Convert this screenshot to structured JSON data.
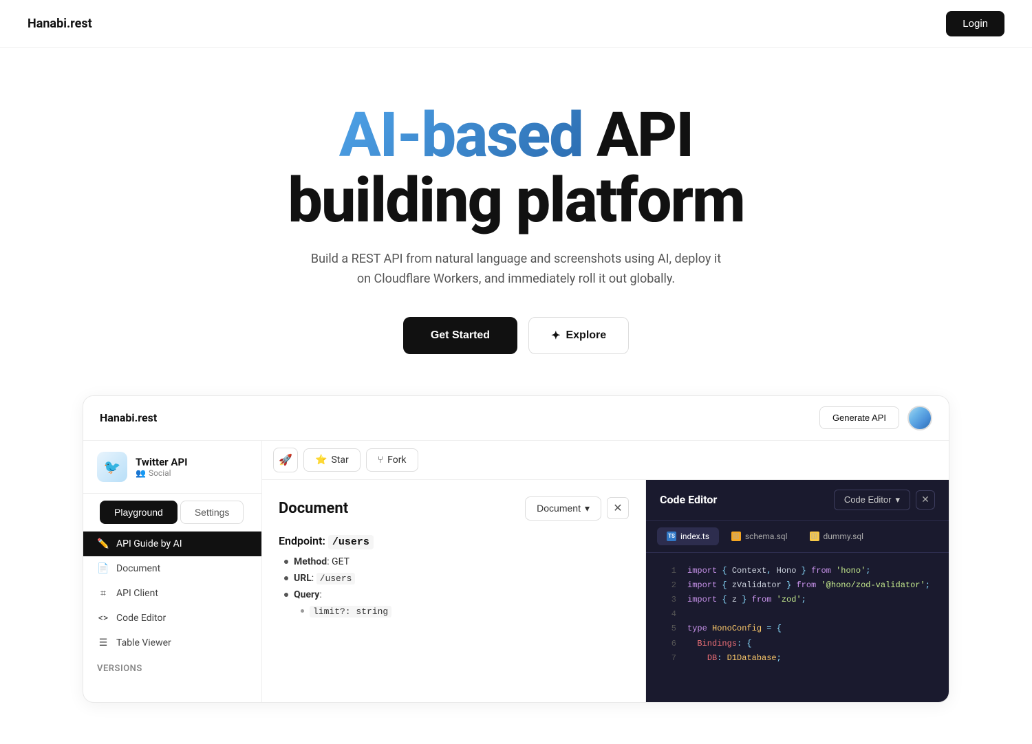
{
  "navbar": {
    "logo": "Hanabi.rest",
    "login_label": "Login"
  },
  "hero": {
    "title_blue": "AI-based",
    "title_rest": " API",
    "title_line2": "building platform",
    "subtitle": "Build a REST API from natural language and screenshots using AI, deploy it on Cloudflare Workers, and immediately roll it out globally.",
    "cta_primary": "Get Started",
    "cta_secondary": "Explore",
    "explore_icon": "✦"
  },
  "demo": {
    "brand": "Hanabi.rest",
    "generate_api_label": "Generate API",
    "project": {
      "name": "Twitter API",
      "category": "Social",
      "category_icon": "👥"
    },
    "tabs": {
      "playground": "Playground",
      "settings": "Settings",
      "rocket_icon": "🚀",
      "star_label": "Star",
      "fork_label": "Fork"
    },
    "sidebar_nav": [
      {
        "id": "api-guide",
        "icon": "✏️",
        "label": "API Guide by AI",
        "active": true
      },
      {
        "id": "document",
        "icon": "📄",
        "label": "Document",
        "active": false
      },
      {
        "id": "api-client",
        "icon": "⌗",
        "label": "API Client",
        "active": false
      },
      {
        "id": "code-editor",
        "icon": "<>",
        "label": "Code Editor",
        "active": false
      },
      {
        "id": "table-viewer",
        "icon": "☰",
        "label": "Table Viewer",
        "active": false
      }
    ],
    "sidebar_versions_label": "Versions",
    "document_panel": {
      "title": "Document",
      "dropdown_label": "Document",
      "endpoint_label": "Endpoint:",
      "endpoint_path": "/users",
      "items": [
        {
          "label": "Method",
          "value": ": GET"
        },
        {
          "label": "URL",
          "value": ": /users"
        },
        {
          "label": "Query",
          "value": ":"
        }
      ],
      "query_sub": [
        {
          "label": "limit?: string"
        }
      ]
    },
    "code_editor": {
      "title": "Code Editor",
      "dropdown_label": "Code Editor",
      "tabs": [
        {
          "id": "index-ts",
          "label": "index.ts",
          "type": "ts",
          "active": true
        },
        {
          "id": "schema-sql",
          "label": "schema.sql",
          "type": "sql-orange",
          "active": false
        },
        {
          "id": "dummy-sql",
          "label": "dummy.sql",
          "type": "sql-yellow",
          "active": false
        }
      ],
      "lines": [
        {
          "num": 1,
          "content": "import { Context, Hono } from 'hono';"
        },
        {
          "num": 2,
          "content": "import { zValidator } from '@hono/zod-validator';"
        },
        {
          "num": 3,
          "content": "import { z } from 'zod';"
        },
        {
          "num": 4,
          "content": ""
        },
        {
          "num": 5,
          "content": "type HonoConfig = {"
        },
        {
          "num": 6,
          "content": "  Bindings: {"
        },
        {
          "num": 7,
          "content": "    DB: D1Database;"
        }
      ]
    }
  }
}
